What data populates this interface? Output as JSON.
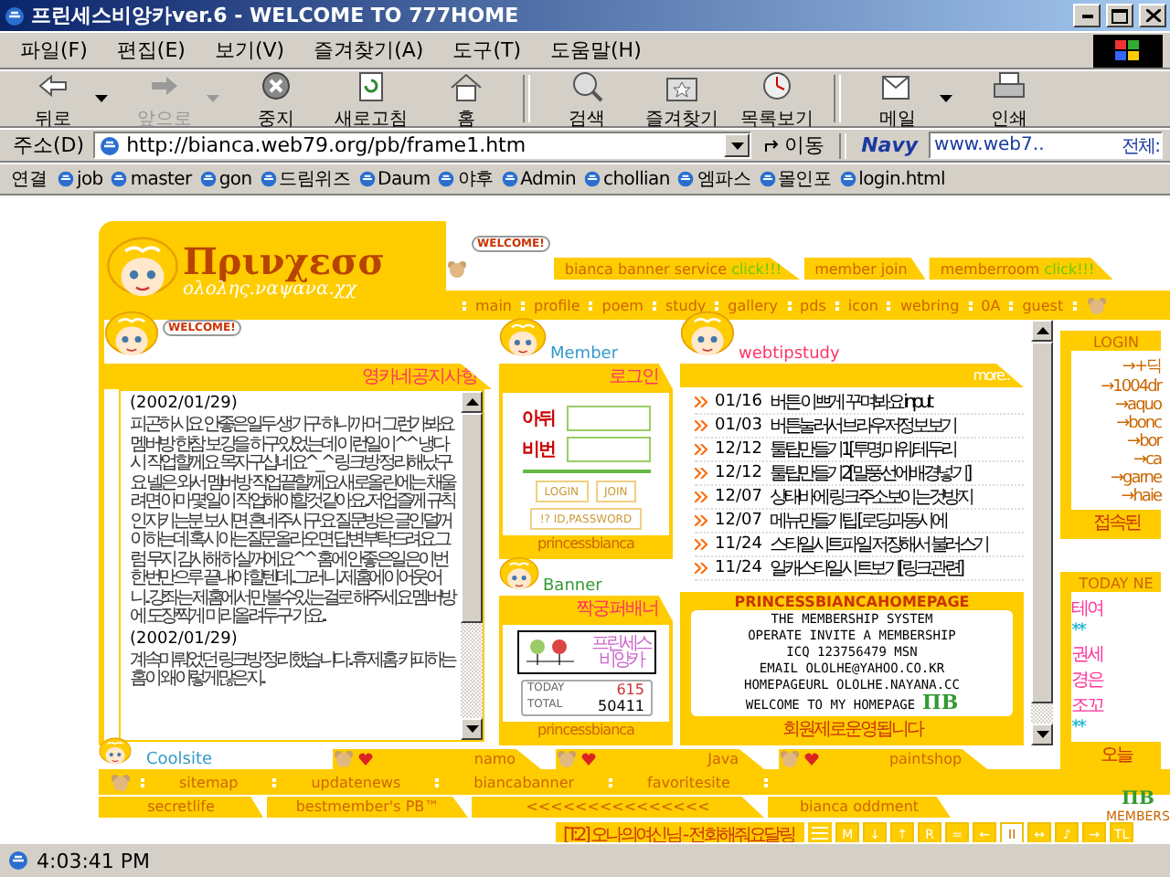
{
  "window": {
    "title": "프린세스비앙카ver.6 - WELCOME TO 777HOME"
  },
  "menu": [
    "파일(F)",
    "편집(E)",
    "보기(V)",
    "즐겨찾기(A)",
    "도구(T)",
    "도움말(H)"
  ],
  "toolbar": [
    [
      {
        "kind": "back",
        "label": "뒤로",
        "disabled": false,
        "dropdown": true
      },
      {
        "kind": "forward",
        "label": "앞으로",
        "disabled": true,
        "dropdown": true
      },
      {
        "kind": "stop",
        "label": "중지",
        "disabled": false,
        "dropdown": false
      },
      {
        "kind": "refresh",
        "label": "새로고침",
        "disabled": false,
        "dropdown": false
      },
      {
        "kind": "home",
        "label": "홈",
        "disabled": false,
        "dropdown": false
      }
    ],
    [
      {
        "kind": "search",
        "label": "검색",
        "disabled": false,
        "dropdown": false
      },
      {
        "kind": "favorites",
        "label": "즐겨찾기",
        "disabled": false,
        "dropdown": false
      },
      {
        "kind": "history",
        "label": "목록보기",
        "disabled": false,
        "dropdown": false
      }
    ],
    [
      {
        "kind": "mail",
        "label": "메일",
        "disabled": false,
        "dropdown": true
      },
      {
        "kind": "print",
        "label": "인쇄",
        "disabled": false,
        "dropdown": false
      }
    ]
  ],
  "address": {
    "label": "주소(D)",
    "value": "http://bianca.web79.org/pb/frame1.htm",
    "go": "이동"
  },
  "navy": {
    "brand": "Navy",
    "value": "www.web7..",
    "label": "전체:"
  },
  "links": {
    "label": "연결",
    "items": [
      "job",
      "master",
      "gon",
      "드림위즈",
      "Daum",
      "야후",
      "Admin",
      "chollian",
      "엠파스",
      "몰인포",
      "login.html"
    ]
  },
  "header": {
    "logo_title": "Πρινχεσσ",
    "logo_subtitle": "ολολης.ναψανα.χχ",
    "welcome_badge": "WELCOME!",
    "top_tabs": [
      {
        "label": "bianca banner service",
        "extra": "click!!!"
      },
      {
        "label": "member join"
      },
      {
        "label": "memberroom",
        "extra": "click!!!"
      }
    ],
    "nav": [
      "main",
      "profile",
      "poem",
      "study",
      "gallery",
      "pds",
      "icon",
      "webring",
      "0A",
      "guest"
    ]
  },
  "notice": {
    "badge": "WELCOME!",
    "title": "영카네공지사항",
    "entries": [
      {
        "date": "(2002/01/29)",
        "text": "피곤하시요 안좋은일두 생기구 하니까 머 그런가봐요 멤버방 한참 보강을 하구있었는데 이런일이^^ 냉다시 작업할께요 목자구십네요^_^ 링크방 정리해났구요 넬은 와서 멤버방 작업끝할께요 새로올린에는 채울려면 아마 몇일이 작업해야할것같아요..저업즐께 규칙인지키는분 보시면 흔네주시구요 질문방은 글인덜꺼이하는데 혹시아는질문올라오면 답변부탁드려요 그럼 무지 감사해 하실꺼에요^^ 홈에 안좋은일은이번한번만으루 끝내야 할텐데..그러니..제홈에이어웃어니..강좌는 제홈에서만 볼수있는걸로 해주세요 멤버방에 도장찍게 미리올려두구 가요.."
      },
      {
        "date": "(2002/01/29)",
        "text": "계속미뤄었던 링크방 정리했습니다..휴 제홈 카피하는홈이 왜이렇게많은지.."
      }
    ]
  },
  "member": {
    "caption": "Member",
    "title": "로그인",
    "fields": [
      "아뒤",
      "비번"
    ],
    "buttons": [
      "LOGIN",
      "JOIN"
    ],
    "find": "!? ID,PASSWORD",
    "footer": "princessbianca"
  },
  "banner": {
    "caption": "Banner",
    "title": "짝궁퍼배너",
    "banner_lines": [
      "프린세스",
      "비앙카"
    ],
    "today_label": "TODAY",
    "today": "615",
    "total_label": "TOTAL",
    "total": "50411",
    "footer": "princessbianca"
  },
  "tips": {
    "caption": "webtipstudy",
    "more": "more..",
    "items": [
      {
        "date": "01/16",
        "title": "버튼 이쁘게 꾸며봐요 input"
      },
      {
        "date": "01/03",
        "title": "버튼눌러서브라우저정보보기"
      },
      {
        "date": "12/12",
        "title": "툴팁만들기1[투명,마위,테두리"
      },
      {
        "date": "12/12",
        "title": "툴팁만들기2[말풍선에배경넣기]"
      },
      {
        "date": "12/07",
        "title": "상태바에 링크주소보이는것방지"
      },
      {
        "date": "12/07",
        "title": "메뉴만들기팁 [로딩과동시에"
      },
      {
        "date": "11/24",
        "title": "스타일시트파일 저장해서 불러스기"
      },
      {
        "date": "11/24",
        "title": "일캐스타일시트보기[링크관련]"
      }
    ]
  },
  "about": {
    "title": "PRINCESSBIANCAHOMEPAGE",
    "lines": [
      "THE MEMBERSHIP SYSTEM",
      "OPERATE INVITE A MEMBERSHIP",
      "ICQ 123756479 MSN",
      "EMAIL OLOLHE@YAHOO.CO.KR",
      "HOMEPAGEURL OLOLHE.NAYANA.CC",
      "WELCOME TO MY HOMEPAGE"
    ],
    "logo": "ΠB",
    "footer": "회원제로운영됩니다"
  },
  "side_login": {
    "title": "LOGIN",
    "items": [
      "→+딕",
      "→1004dr",
      "→aquo",
      "→bonc",
      "→bor",
      "→ca",
      "→garne",
      "→haie"
    ],
    "footer": "접속된"
  },
  "today": {
    "title": "TODAY NE",
    "items": [
      {
        "text": "테여",
        "color": "#ff3399"
      },
      {
        "text": "**",
        "color": "#00aacc"
      },
      {
        "text": "권세",
        "color": "#ff3399"
      },
      {
        "text": "경은",
        "color": "#ff3399"
      },
      {
        "text": "조꼬",
        "color": "#ff3399"
      },
      {
        "text": "**",
        "color": "#00aacc"
      }
    ],
    "footer": "오늘"
  },
  "bottom_tabs": {
    "caption": "Coolsite",
    "tabs": [
      "namo",
      "Java",
      "paintshop"
    ]
  },
  "footer_nav": [
    "sitemap",
    "updatenews",
    "biancabanner",
    "favoritesite"
  ],
  "footer_tabs": [
    "secretlife",
    "bestmember's PB™",
    "<<<<<<<<<<<<<<<",
    "bianca oddment"
  ],
  "members": {
    "logo": "ΠB",
    "label": "MEMBERS"
  },
  "player": {
    "track": "[T:2] 오나의여신님 - 전화해줘요달링",
    "buttons": [
      {
        "label": "M",
        "selected": false
      },
      {
        "label": "↓",
        "selected": false
      },
      {
        "label": "↑",
        "selected": false
      },
      {
        "label": "R",
        "selected": false
      },
      {
        "label": "=",
        "selected": false
      },
      {
        "label": "←",
        "selected": false
      },
      {
        "label": "II",
        "selected": true
      },
      {
        "label": "↔",
        "selected": false
      },
      {
        "label": "♪",
        "selected": false
      },
      {
        "label": "→",
        "selected": false
      },
      {
        "label": "TL",
        "selected": false
      }
    ]
  },
  "status": {
    "time": "4:03:41 PM"
  }
}
